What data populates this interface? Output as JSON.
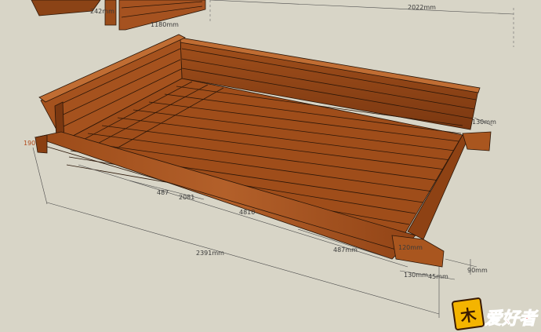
{
  "dimensions": {
    "d_242": "242mm",
    "d_2022": "2022mm",
    "d_1180": "1180mm",
    "d_130_top": "130mm",
    "d_190": "190",
    "d_487_a": "487",
    "d_2081": "2081",
    "d_4810": "4810",
    "d_487_b": "487mm",
    "d_2391": "2391mm",
    "d_120": "120mm",
    "d_130": "130mm",
    "d_45": "45mm",
    "d_90": "90mm"
  },
  "logo": {
    "mark": "木",
    "text": "爱好者"
  },
  "colors": {
    "background": "#d8d5c7",
    "wood": "#a8531f",
    "wood_dark": "#7a3510",
    "dimension": "#3a3a3a"
  }
}
